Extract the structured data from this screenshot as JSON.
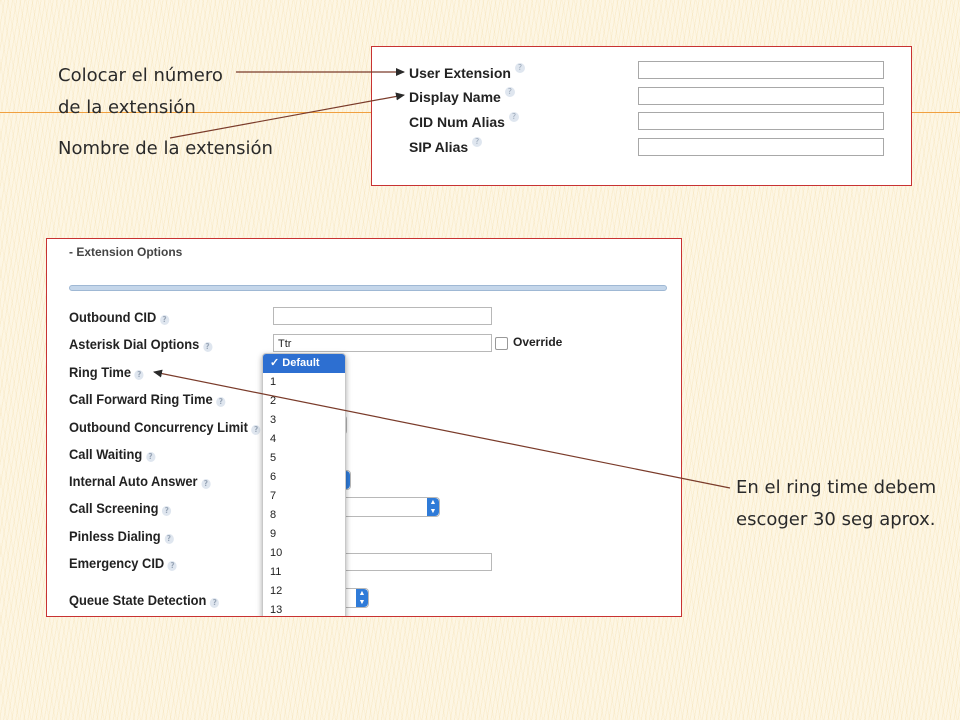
{
  "annotations": {
    "top_line1": "Colocar el número",
    "top_line2": "de la extensión",
    "name": "Nombre de la extensión",
    "ring_line1": "En el ring time debem",
    "ring_line2": "escoger 30 seg aprox."
  },
  "top_form": {
    "fields": [
      {
        "label": "User Extension",
        "value": ""
      },
      {
        "label": "Display Name",
        "value": ""
      },
      {
        "label": "CID Num Alias",
        "value": ""
      },
      {
        "label": "SIP Alias",
        "value": ""
      }
    ]
  },
  "extension_options": {
    "title": "- Extension Options",
    "rows": [
      "Outbound CID",
      "Asterisk Dial Options",
      "Ring Time",
      "Call Forward Ring Time",
      "Outbound Concurrency Limit",
      "Call Waiting",
      "Internal Auto Answer",
      "Call Screening",
      "Pinless Dialing",
      "Emergency CID",
      "Queue State Detection"
    ],
    "outbound_cid_value": "",
    "dial_options_value": "Ttr",
    "override_label": "Override",
    "emergency_cid_value": ""
  },
  "ring_time_dropdown": {
    "selected": "✓ Default",
    "options": [
      "1",
      "2",
      "3",
      "4",
      "5",
      "6",
      "7",
      "8",
      "9",
      "10",
      "11",
      "12",
      "13"
    ]
  },
  "colors": {
    "frame_border": "#c83232",
    "selection": "#2d6fd1",
    "select_arrow": "#2f7bd8",
    "background": "#fdf6e4"
  }
}
